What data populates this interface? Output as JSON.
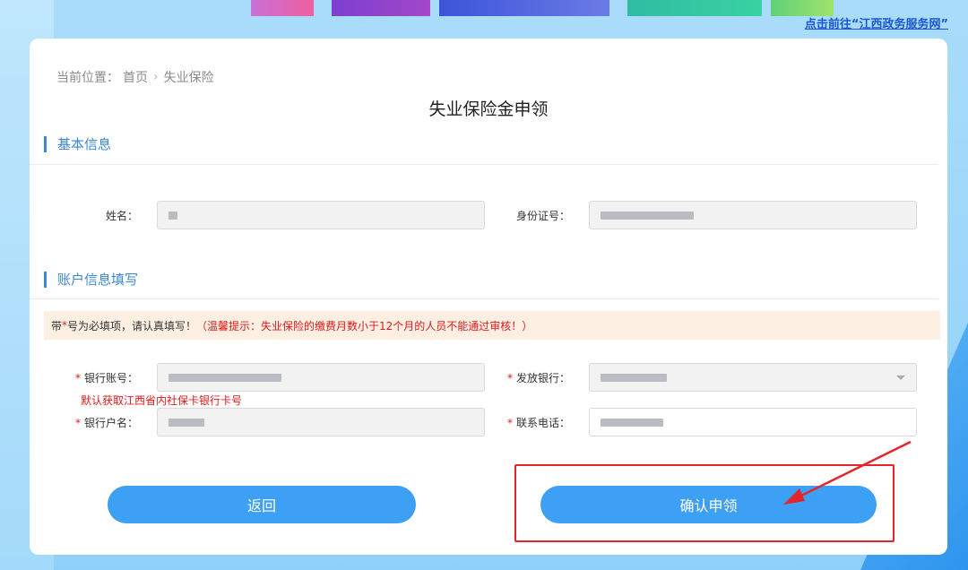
{
  "header": {
    "portal_link": "点击前往“江西政务服务网”"
  },
  "breadcrumb": {
    "prefix": "当前位置：",
    "home": "首页",
    "current": "失业保险"
  },
  "page_title": "失业保险金申领",
  "basic_section": {
    "title": "基本信息",
    "name_label": "姓名：",
    "id_label": "身份证号："
  },
  "account_section": {
    "title": "账户信息填写",
    "notice_prefix": "带",
    "notice_star": "*",
    "notice_main": " 号为必填项，请认真填写！",
    "notice_warning": "（温馨提示：失业保险的缴费月数小于12个月的人员不能通过审核！）",
    "bank_account_label": "银行账号：",
    "bank_account_hint": "默认获取江西省内社保卡银行卡号",
    "issuing_bank_label": "发放银行：",
    "account_holder_label": "银行户名：",
    "phone_label": "联系电话：",
    "required_mark": "*"
  },
  "buttons": {
    "back": "返回",
    "confirm": "确认申领"
  },
  "colors": {
    "accent": "#3da0f4",
    "section": "#3d88d6",
    "warning": "#e0191b",
    "highlight": "#e3262b"
  }
}
